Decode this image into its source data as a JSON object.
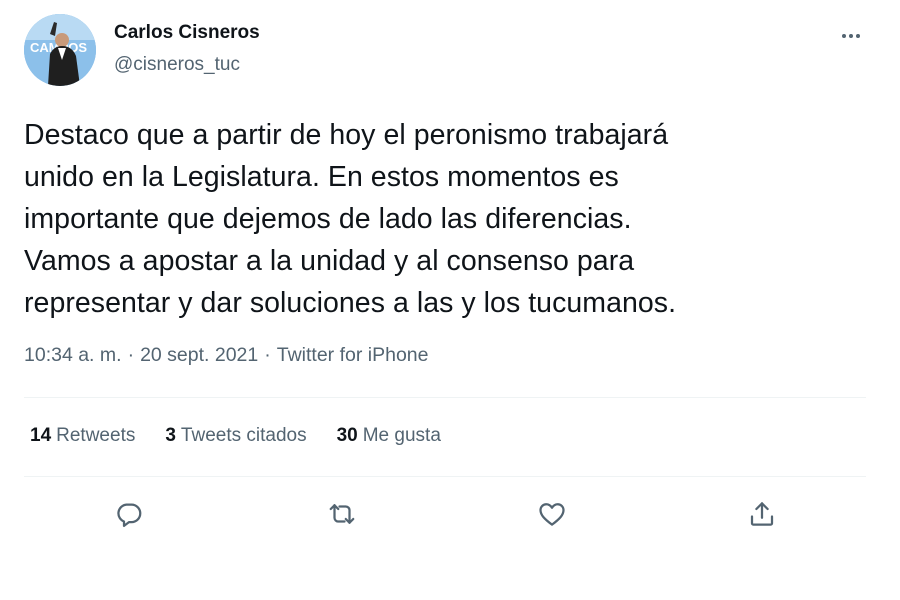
{
  "author": {
    "name": "Carlos Cisneros",
    "handle": "@cisneros_tuc",
    "avatar_logo_text": "CAMPOS"
  },
  "tweet": {
    "text_lines": [
      "Destaco que a partir de hoy el peronismo trabajará",
      "unido en la Legislatura. En estos momentos es",
      "importante que dejemos de lado las diferencias.",
      "Vamos a apostar a la unidad y al consenso para",
      "representar y dar soluciones a las y los tucumanos."
    ],
    "time": "10:34 a. m.",
    "separator": "·",
    "date": "20 sept. 2021",
    "source": "Twitter for iPhone"
  },
  "stats": {
    "retweets_count": "14",
    "retweets_label": "Retweets",
    "quotes_count": "3",
    "quotes_label": "Tweets citados",
    "likes_count": "30",
    "likes_label": "Me gusta"
  },
  "icons": {
    "more": "more-horizontal-icon",
    "reply": "reply-icon",
    "retweet": "retweet-icon",
    "like": "heart-icon",
    "share": "share-icon"
  },
  "colors": {
    "text_primary": "#0f1419",
    "text_secondary": "#536471",
    "divider": "#eff3f4",
    "avatar_bg": "#7fb7e6"
  }
}
